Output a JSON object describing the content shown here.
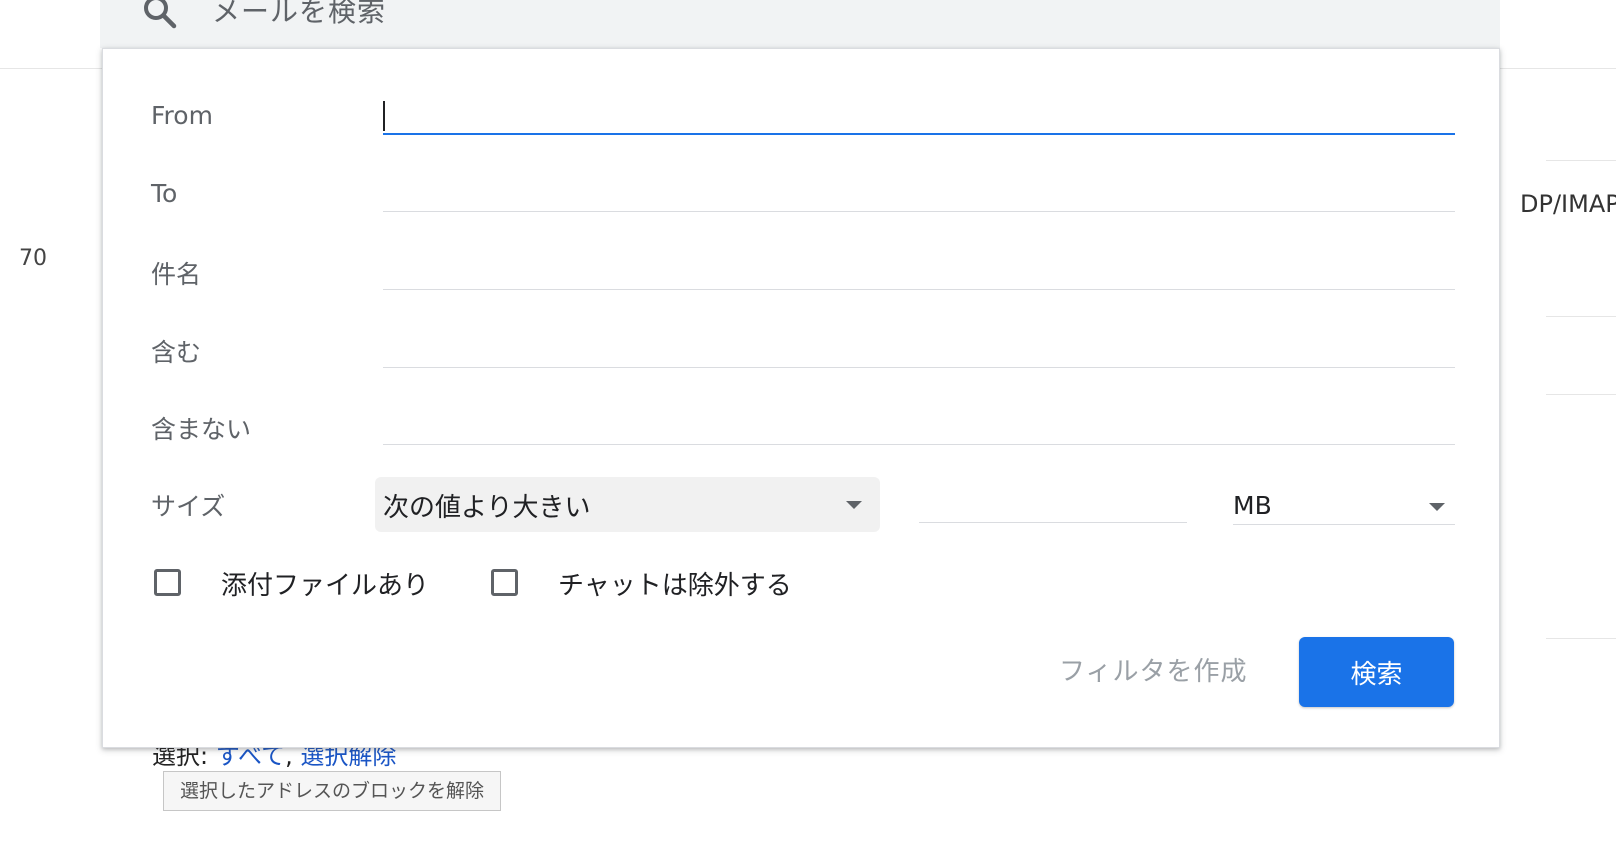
{
  "search": {
    "placeholder": "メールを検索"
  },
  "background": {
    "count_number": "70",
    "protocol_fragment": "DP/IMAP",
    "selection": {
      "prefix": "選択:",
      "all_link": "すべて",
      "separator": ",",
      "none_link": "選択解除"
    },
    "unblock_button": "選択したアドレスのブロックを解除"
  },
  "dialog": {
    "labels": {
      "from": "From",
      "to": "To",
      "subject": "件名",
      "has_words": "含む",
      "doesnt_have": "含まない",
      "size": "サイズ"
    },
    "fields": {
      "from_value": "",
      "to_value": "",
      "subject_value": "",
      "has_words_value": "",
      "doesnt_have_value": "",
      "size_value": ""
    },
    "size_operator": "次の値より大きい",
    "size_unit": "MB",
    "checkboxes": {
      "has_attachment": {
        "label": "添付ファイルあり",
        "checked": false
      },
      "exclude_chats": {
        "label": "チャットは除外する",
        "checked": false
      }
    },
    "create_filter_label": "フィルタを作成",
    "search_button_label": "検索"
  },
  "colors": {
    "accent": "#1a73e8",
    "label_gray": "#5f6368",
    "divider": "#dadce0",
    "disabled_text": "#9aa0a6"
  },
  "icons": {
    "search": "magnifier-icon",
    "dropdown": "triangle-down-icon"
  }
}
